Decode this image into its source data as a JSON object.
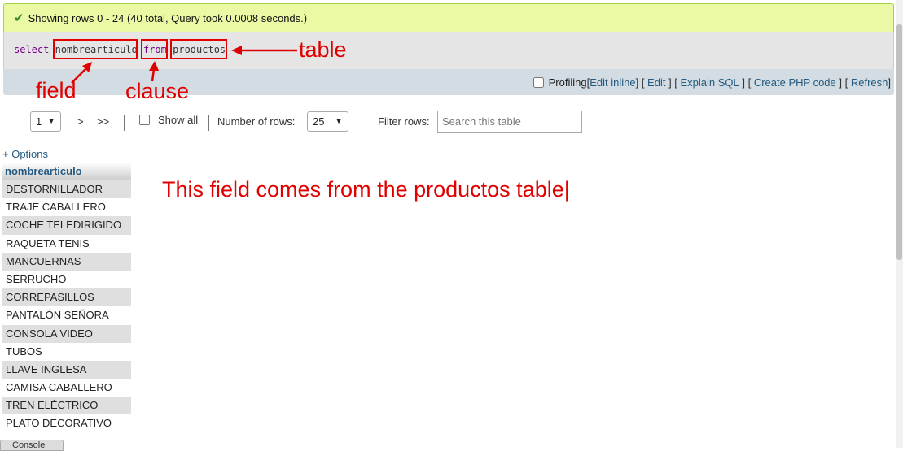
{
  "banner": {
    "message": "Showing rows 0 - 24 (40 total, Query took 0.0008 seconds.)"
  },
  "sql": {
    "select_kw": "select",
    "field": "nombrearticulo",
    "from_kw": "from",
    "table": "productos"
  },
  "toolbar": {
    "profiling_label": "Profiling",
    "links": [
      "Edit inline",
      "Edit",
      "Explain SQL",
      "Create PHP code",
      "Refresh"
    ]
  },
  "nav": {
    "page_value": "1",
    "next": ">",
    "last": ">>",
    "show_all_label": "Show all",
    "rows_label": "Number of rows:",
    "rows_value": "25",
    "filter_label": "Filter rows:",
    "filter_placeholder": "Search this table"
  },
  "results": {
    "options_label": "+ Options",
    "column_header": "nombrearticulo",
    "rows": [
      "DESTORNILLADOR",
      "TRAJE CABALLERO",
      "COCHE TELEDIRIGIDO",
      "RAQUETA TENIS",
      "MANCUERNAS",
      "SERRUCHO",
      "CORREPASILLOS",
      "PANTALÓN SEÑORA",
      "CONSOLA VIDEO",
      "TUBOS",
      "LLAVE INGLESA",
      "CAMISA CABALLERO",
      "TREN ELÉCTRICO",
      "PLATO DECORATIVO"
    ]
  },
  "console_label": "Console",
  "annotations": {
    "table_label": "table",
    "field_label": "field",
    "clause_label": "clause",
    "note": "This field comes from the productos table|",
    "color": "#e00000"
  },
  "icons": {
    "success": "check-icon",
    "dropdown": "chevron-down-icon"
  }
}
